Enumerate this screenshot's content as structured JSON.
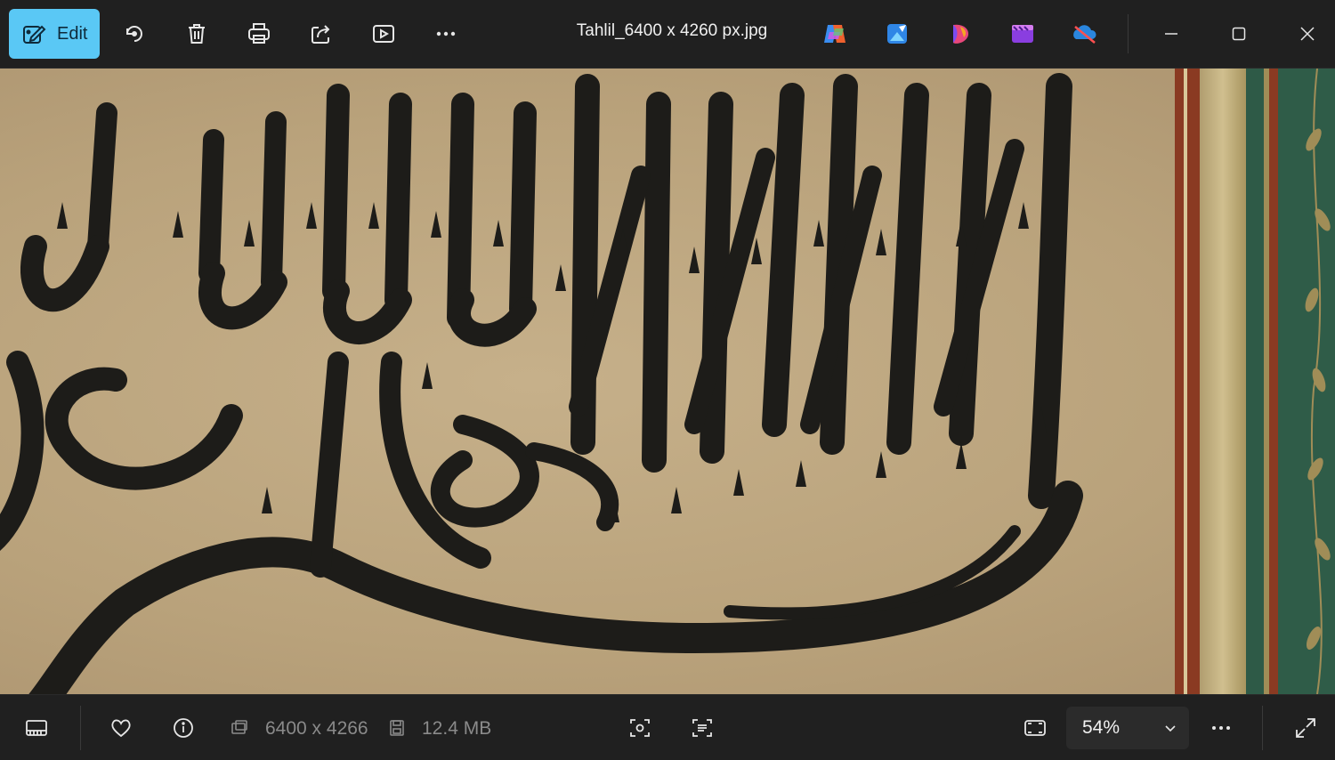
{
  "toolbar": {
    "edit_label": "Edit",
    "file_name": "Tahlil_6400 x 4260 px.jpg",
    "icons": [
      "edit-icon",
      "rotate-icon",
      "delete-icon",
      "print-icon",
      "share-icon",
      "slideshow-icon",
      "more-icon"
    ],
    "app_icons": [
      "copilot-icon",
      "photo-editor-icon",
      "clipchamp-icon",
      "designer-icon",
      "onedrive-icon"
    ]
  },
  "image": {
    "description_colors": {
      "paper": "#b9a27b",
      "ink": "#1d1c19",
      "border_red": "#8a3a22",
      "border_green": "#2e5a47",
      "border_gold": "#a08d57"
    }
  },
  "statusbar": {
    "dimensions": "6400 x 4266",
    "file_size": "12.4 MB",
    "zoom": "54%"
  },
  "colors": {
    "accent": "#5ac8f5",
    "toolbar_bg": "#202020",
    "muted_text": "#8a8a8a"
  }
}
